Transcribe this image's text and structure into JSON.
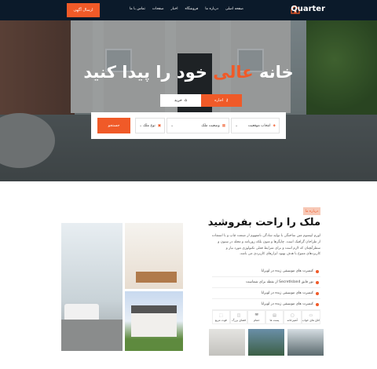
{
  "nav": {
    "brand": "Quarter",
    "links": [
      "صفحه اصلی",
      "درباره ما",
      "فروشگاه",
      "اخبار",
      "صفحات",
      "تماس با ما"
    ],
    "cta": "ارسال آگهی"
  },
  "hero": {
    "title_pre": "خانه ",
    "title_highlight": "عالی",
    "title_post": " خود را پیدا کنید",
    "tab_rent": "اجاره",
    "tab_buy": "خرید",
    "search_button": "جستجو",
    "fields": [
      "انتخاب موقعیت",
      "وضعیت ملک",
      "نوع ملک"
    ]
  },
  "about": {
    "badge": "درباره ما",
    "title": "ملک را راحت بفروشید",
    "text": "لورم ایپسوم متن ساختگی با تولید سادگی نامفهوم از صنعت چاپ و با استفاده از طراحان گرافیک است. چاپگرها و متون بلکه روزنامه و مجله در ستون و سطرآنچنان که لازم است و برای شرایط فعلی تکنولوژی مورد نیاز و کاربردهای متنوع با هدف بهبود ابزارهای کاربردی می باشد.",
    "features": [
      "کنسرت های موسیقی زنده در لوبرانا",
      "تور قایق SecretIsland از نقطه برای شماست",
      "کنسرت های موسیقی زنده در لوبرانا",
      "کنسرت های موسیقی زنده در لوبرانا"
    ],
    "specs": [
      "اتاق های خواب",
      "آشپزخانه",
      "پست ها",
      "حمام",
      "فضای بزرگ",
      "فوت مربع"
    ]
  },
  "colors": {
    "accent": "#f05a28",
    "navbar": "#0b1a2a"
  }
}
